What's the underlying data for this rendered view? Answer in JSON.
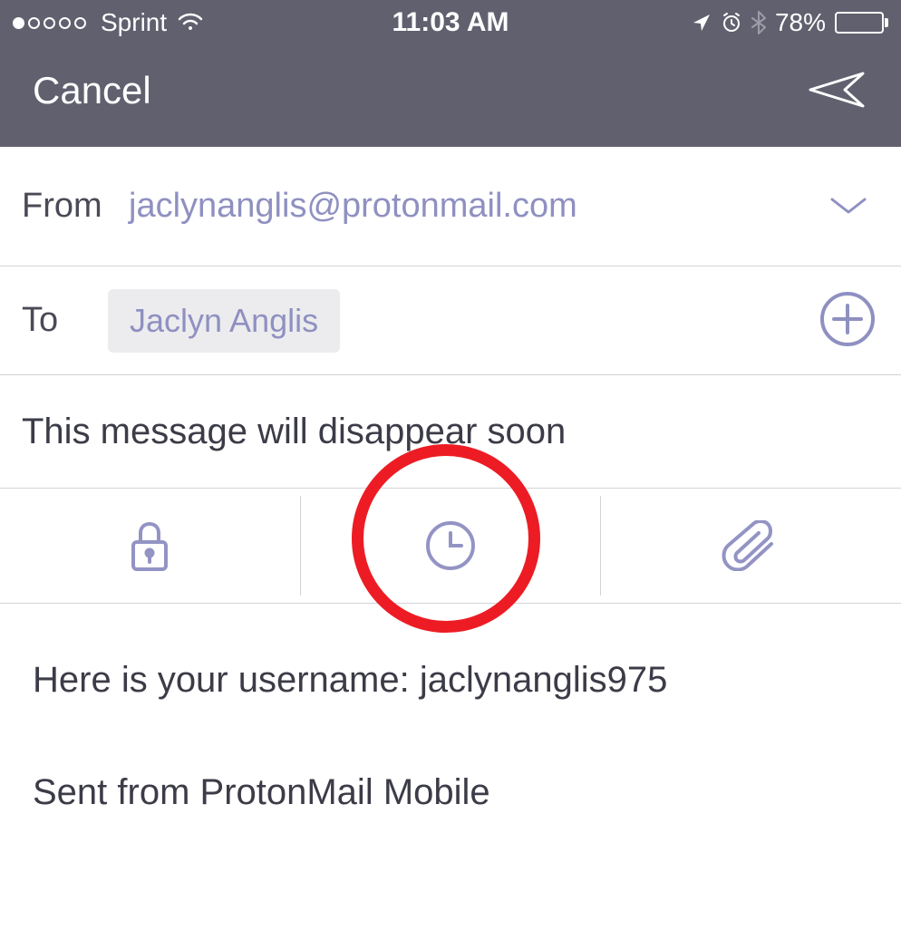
{
  "status_bar": {
    "carrier": "Sprint",
    "time": "11:03 AM",
    "battery_pct": "78%"
  },
  "nav": {
    "cancel_label": "Cancel"
  },
  "compose": {
    "from_label": "From",
    "from_email": "jaclynanglis@protonmail.com",
    "to_label": "To",
    "recipient_name": "Jaclyn Anglis",
    "subject": "This message will disappear soon"
  },
  "body": {
    "line1": "Here is your username: jaclynanglis975",
    "line2": "Sent from ProtonMail Mobile"
  },
  "icons": {
    "lock": "lock-icon",
    "clock": "clock-icon",
    "paperclip": "paperclip-icon"
  }
}
